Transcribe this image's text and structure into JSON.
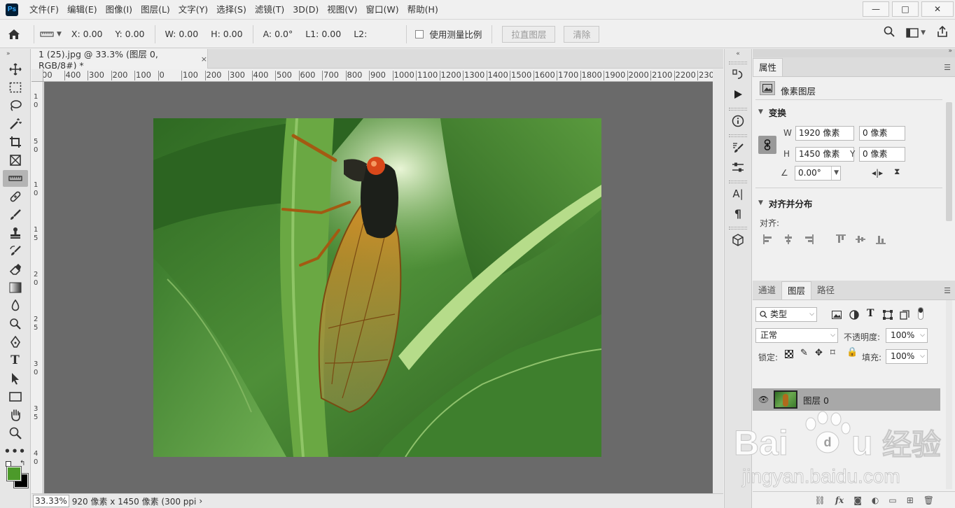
{
  "menu": {
    "logo": "Ps",
    "items": [
      "文件(F)",
      "编辑(E)",
      "图像(I)",
      "图层(L)",
      "文字(Y)",
      "选择(S)",
      "滤镜(T)",
      "3D(D)",
      "视图(V)",
      "窗口(W)",
      "帮助(H)"
    ]
  },
  "window": {
    "minimize": "—",
    "maximize": "□",
    "close": "✕"
  },
  "options": {
    "x": "X: 0.00",
    "y": "Y: 0.00",
    "w": "W: 0.00",
    "h": "H: 0.00",
    "a": "A: 0.0°",
    "l1": "L1: 0.00",
    "l2": "L2:",
    "scale_label": "使用测量比例",
    "straighten_button": "拉直图层",
    "clear_button": "清除"
  },
  "document": {
    "tab_title": "1 (25).jpg @ 33.3% (图层 0, RGB/8#) *",
    "tab_close": "×",
    "ruler_labels": [
      "00",
      "400",
      "300",
      "200",
      "100",
      "0",
      "100",
      "200",
      "300",
      "400",
      "500",
      "600",
      "700",
      "800",
      "900",
      "1000",
      "1100",
      "1200",
      "1300",
      "1400",
      "1500",
      "1600",
      "1700",
      "1800",
      "1900",
      "2000",
      "2100",
      "2200",
      "2300"
    ],
    "zoom": "33.33%",
    "doc_info": "920 像素 x 1450 像素 (300 ppi",
    "arrow": "›"
  },
  "properties": {
    "tab": "属性",
    "kind_label": "像素图层",
    "transform_title": "变换",
    "w_label": "W",
    "w_value": "1920 像素",
    "x_label": "X",
    "x_value": "0 像素",
    "h_label": "H",
    "h_value": "1450 像素",
    "y_label": "Y",
    "y_value": "0 像素",
    "angle_value": "0.00°",
    "align_title": "对齐并分布",
    "align_label": "对齐:"
  },
  "layers": {
    "tabs": [
      "通道",
      "图层",
      "路径"
    ],
    "active_tab": "图层",
    "filter_kind": "类型",
    "blend_mode": "正常",
    "opacity_label": "不透明度:",
    "opacity_value": "100%",
    "lock_label": "锁定:",
    "fill_label": "填充:",
    "fill_value": "100%",
    "layer_name": "图层 0",
    "bottom_fx": "fx"
  },
  "watermark": {
    "brand": "Baidu",
    "cn": "经验",
    "url": "jingyan.baidu.com"
  },
  "colors": {
    "foreground": "#4c9a2a",
    "background": "#000000",
    "canvas_bg": "#6a6a6a",
    "selected_layer": "#a8a8a8"
  }
}
